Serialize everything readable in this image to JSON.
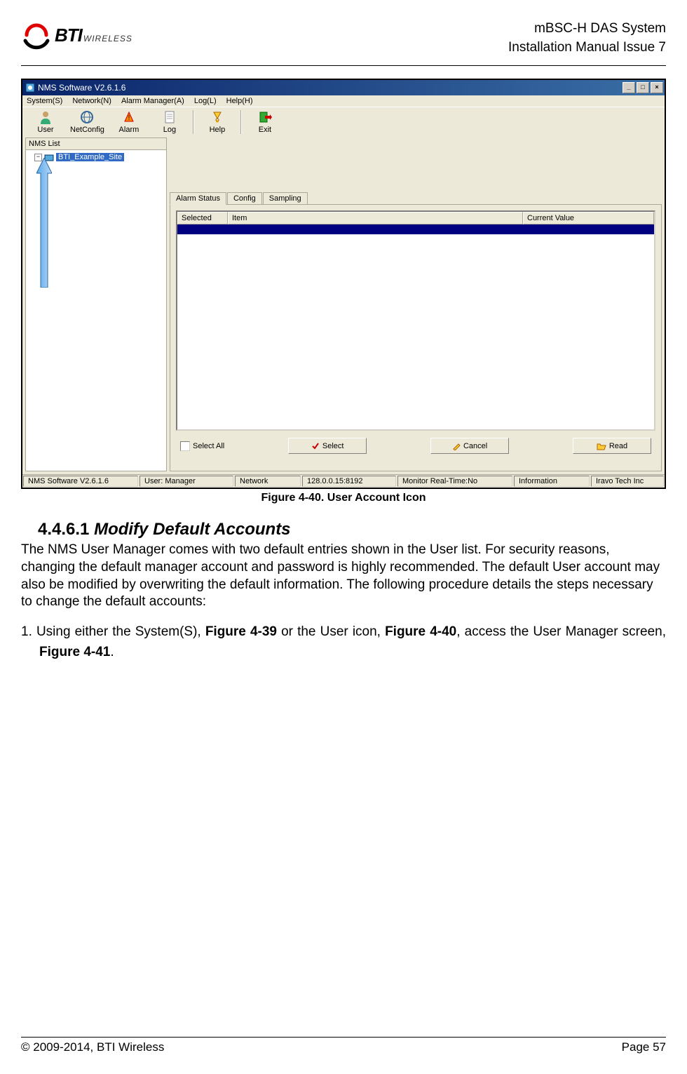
{
  "header": {
    "logo_main": "BTI",
    "logo_sub": "WIRELESS",
    "title_line1": "mBSC-H DAS System",
    "title_line2": "Installation Manual Issue 7"
  },
  "screenshot": {
    "window_title": "NMS Software V2.6.1.6",
    "menu": [
      "System(S)",
      "Network(N)",
      "Alarm Manager(A)",
      "Log(L)",
      "Help(H)"
    ],
    "toolbar": [
      {
        "label": "User",
        "icon": "user-icon"
      },
      {
        "label": "NetConfig",
        "icon": "netconfig-icon"
      },
      {
        "label": "Alarm",
        "icon": "alarm-icon"
      },
      {
        "label": "Log",
        "icon": "log-icon"
      },
      {
        "sep": true
      },
      {
        "label": "Help",
        "icon": "help-icon"
      },
      {
        "sep": true
      },
      {
        "label": "Exit",
        "icon": "exit-icon"
      }
    ],
    "tree": {
      "header": "NMS List",
      "node": "BTI_Example_Site"
    },
    "tabs": [
      "Alarm Status",
      "Config",
      "Sampling"
    ],
    "table_headers": [
      "Selected",
      "Item",
      "Current Value"
    ],
    "select_all": "Select All",
    "buttons": {
      "select": "Select",
      "cancel": "Cancel",
      "read": "Read"
    },
    "status": {
      "version": "NMS Software V2.6.1.6",
      "user": "User: Manager",
      "network": "Network",
      "address": "128.0.0.15:8192",
      "monitor": "Monitor Real-Time:No",
      "info": "Information",
      "company": "Iravo Tech Inc"
    }
  },
  "caption": "Figure 4-40. User Account Icon",
  "section": {
    "number": "4.4.6.1",
    "title": "Modify Default Accounts"
  },
  "para1": "The NMS User Manager comes with two default entries shown in the User list. For security reasons, changing the default manager account and password is highly recommended. The default User account may also be modified by overwriting the default information. The following procedure details the steps necessary to change the default accounts:",
  "step1_prefix": "1.  Using either the System(S), ",
  "step1_fig1": "Figure 4-39",
  "step1_mid1": " or the User icon, ",
  "step1_fig2": "Figure 4-40",
  "step1_mid2": ", access the User Manager screen, ",
  "step1_fig3": "Figure 4-41",
  "step1_end": ".",
  "footer": {
    "copyright": "© 2009-2014, BTI Wireless",
    "page": "Page 57"
  }
}
